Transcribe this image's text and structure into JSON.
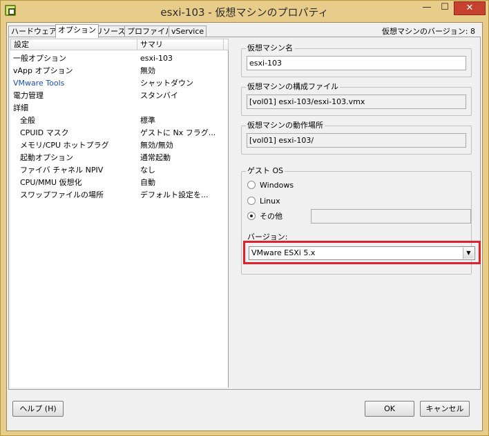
{
  "window": {
    "title": "esxi-103 - 仮想マシンのプロパティ",
    "minimize_glyph": "—",
    "maximize_glyph": "☐",
    "close_glyph": "✕",
    "app_icon": "vm-properties-icon"
  },
  "tabs": [
    {
      "label": "ハードウェア"
    },
    {
      "label": "オプション"
    },
    {
      "label": "リソース"
    },
    {
      "label": "プロファイル"
    },
    {
      "label": "vService"
    }
  ],
  "active_tab": "オプション",
  "version_label": "仮想マシンのバージョン: 8",
  "list": {
    "headers": {
      "setting": "設定",
      "summary": "サマリ"
    },
    "rows": [
      {
        "setting": "一般オプション",
        "summary": "esxi-103"
      },
      {
        "setting": "vApp オプション",
        "summary": "無効"
      },
      {
        "setting": "VMware Tools",
        "summary": "シャットダウン"
      },
      {
        "setting": "電力管理",
        "summary": "スタンバイ"
      },
      {
        "setting": "詳細",
        "summary": ""
      },
      {
        "setting": "全般",
        "summary": "標準"
      },
      {
        "setting": "CPUID マスク",
        "summary": "ゲストに Nx フラグ..."
      },
      {
        "setting": "メモリ/CPU ホットプラグ",
        "summary": "無効/無効"
      },
      {
        "setting": "起動オプション",
        "summary": "通常起動"
      },
      {
        "setting": "ファイバ チャネル NPIV",
        "summary": "なし"
      },
      {
        "setting": "CPU/MMU 仮想化",
        "summary": "自動"
      },
      {
        "setting": "スワップファイルの場所",
        "summary": "デフォルト設定を..."
      }
    ]
  },
  "vm_name": {
    "legend": "仮想マシン名",
    "value": "esxi-103"
  },
  "config_file": {
    "legend": "仮想マシンの構成ファイル",
    "value": "[vol01] esxi-103/esxi-103.vmx"
  },
  "working_location": {
    "legend": "仮想マシンの動作場所",
    "value": "[vol01] esxi-103/"
  },
  "guest_os": {
    "legend": "ゲスト OS",
    "options": [
      {
        "label": "Windows",
        "selected": false
      },
      {
        "label": "Linux",
        "selected": false
      },
      {
        "label": "その他",
        "selected": true
      }
    ],
    "other_value": "",
    "version_label": "バージョン:",
    "version_value": "VMware ESXi 5.x",
    "dropdown_arrow": "▼"
  },
  "buttons": {
    "help": "ヘルプ (H)",
    "ok": "OK",
    "cancel": "キャンセル"
  },
  "colors": {
    "highlight": "#e0202a",
    "link": "#1a4fc0",
    "frame": "#e8cd8a"
  }
}
